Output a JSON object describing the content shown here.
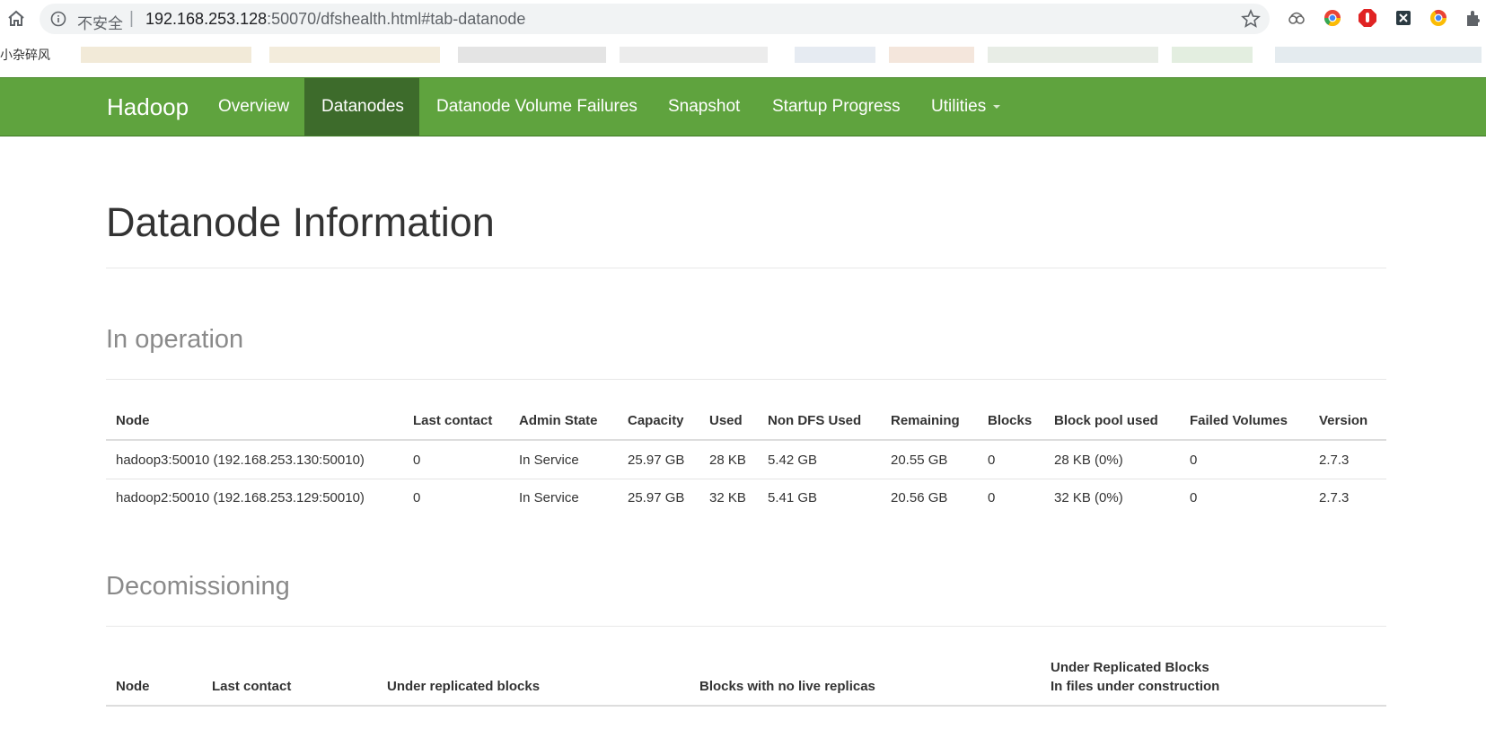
{
  "browser": {
    "security_label": "不安全",
    "url_host": "192.168.253.128",
    "url_rest": ":50070/dfshealth.html#tab-datanode",
    "bookmark_label": "小杂碎风",
    "icons": [
      "home-icon",
      "info-icon",
      "star-icon",
      "cloud-link-icon",
      "chrome-icon",
      "adblock-icon",
      "x-icon",
      "chrome-alt-icon",
      "puzzle-icon"
    ]
  },
  "navbar": {
    "brand": "Hadoop",
    "items": [
      {
        "label": "Overview"
      },
      {
        "label": "Datanodes"
      },
      {
        "label": "Datanode Volume Failures"
      },
      {
        "label": "Snapshot"
      },
      {
        "label": "Startup Progress"
      },
      {
        "label": "Utilities"
      }
    ],
    "color": "#5fa33e",
    "active_color": "#3d6b2b"
  },
  "page": {
    "title": "Datanode Information"
  },
  "in_operation": {
    "title": "In operation",
    "headers": [
      "Node",
      "Last contact",
      "Admin State",
      "Capacity",
      "Used",
      "Non DFS Used",
      "Remaining",
      "Blocks",
      "Block pool used",
      "Failed Volumes",
      "Version"
    ],
    "rows": [
      [
        "hadoop3:50010 (192.168.253.130:50010)",
        "0",
        "In Service",
        "25.97 GB",
        "28 KB",
        "5.42 GB",
        "20.55 GB",
        "0",
        "28 KB (0%)",
        "0",
        "2.7.3"
      ],
      [
        "hadoop2:50010 (192.168.253.129:50010)",
        "0",
        "In Service",
        "25.97 GB",
        "32 KB",
        "5.41 GB",
        "20.56 GB",
        "0",
        "32 KB (0%)",
        "0",
        "2.7.3"
      ]
    ]
  },
  "decommissioning": {
    "title": "Decomissioning",
    "headers": [
      "Node",
      "Last contact",
      "Under replicated blocks",
      "Blocks with no live replicas"
    ],
    "last_header_line1": "Under Replicated Blocks",
    "last_header_line2": "In files under construction"
  }
}
